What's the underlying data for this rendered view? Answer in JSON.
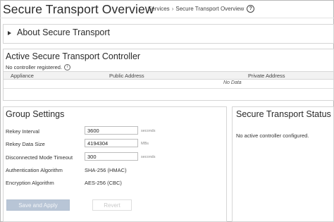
{
  "header": {
    "title": "Secure Transport Overview",
    "breadcrumb": {
      "parent": "Services",
      "separator": "›",
      "current": "Secure Transport Overview"
    },
    "help_glyph": "?"
  },
  "about": {
    "label": "About Secure Transport"
  },
  "controller": {
    "title": "Active Secure Transport Controller",
    "note": "No controller registered.",
    "info_glyph": "i",
    "columns": [
      "Appliance",
      "Public Address",
      "Private Address"
    ],
    "empty_text": "No Data"
  },
  "group_settings": {
    "title": "Group Settings",
    "rekey_interval": {
      "label": "Rekey Interval",
      "value": "3600",
      "unit": "seconds"
    },
    "rekey_data_size": {
      "label": "Rekey Data Size",
      "value": "4194304",
      "unit": "MBs"
    },
    "disconnected_timeout": {
      "label": "Disconnected Mode Timeout",
      "value": "300",
      "unit": "seconds"
    },
    "auth_algorithm": {
      "label": "Authentication Algorithm",
      "value": "SHA-256 (HMAC)"
    },
    "enc_algorithm": {
      "label": "Encryption Algorithm",
      "value": "AES-256 (CBC)"
    },
    "save_label": "Save and Apply",
    "revert_label": "Revert"
  },
  "status": {
    "title": "Secure Transport Status",
    "message": "No active controller configured."
  }
}
